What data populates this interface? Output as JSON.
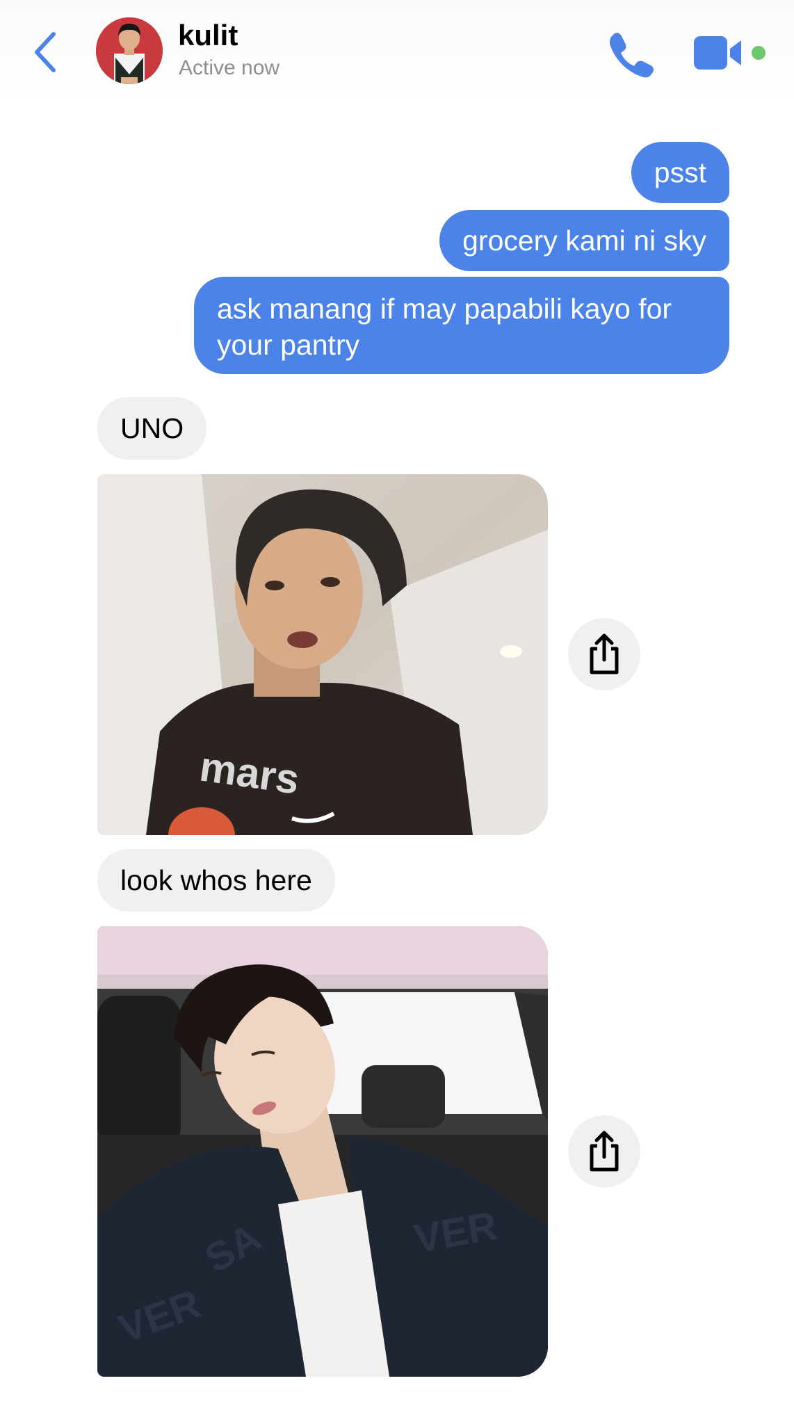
{
  "header": {
    "back_icon": "chevron-left-icon",
    "contact_name": "kulit",
    "status": "Active now",
    "call_icon": "phone-icon",
    "video_icon": "video-camera-icon",
    "online_dot_color": "#6cc86c",
    "accent_color": "#4b83e8"
  },
  "messages": [
    {
      "direction": "outgoing",
      "type": "text",
      "text": "psst"
    },
    {
      "direction": "outgoing",
      "type": "text",
      "text": "grocery kami ni sky"
    },
    {
      "direction": "outgoing",
      "type": "text",
      "text": "ask manang if may papabili kayo for your pantry"
    },
    {
      "direction": "incoming",
      "type": "text",
      "text": "UNO"
    },
    {
      "direction": "incoming",
      "type": "image",
      "shirt_text": "mars",
      "share_icon": "share-icon"
    },
    {
      "direction": "incoming",
      "type": "text",
      "text": "look whos here"
    },
    {
      "direction": "incoming",
      "type": "image",
      "share_icon": "share-icon"
    }
  ],
  "colors": {
    "outgoing_bubble": "#4b83e8",
    "incoming_bubble": "#f0f0f0",
    "status_text": "#8e8e93"
  }
}
